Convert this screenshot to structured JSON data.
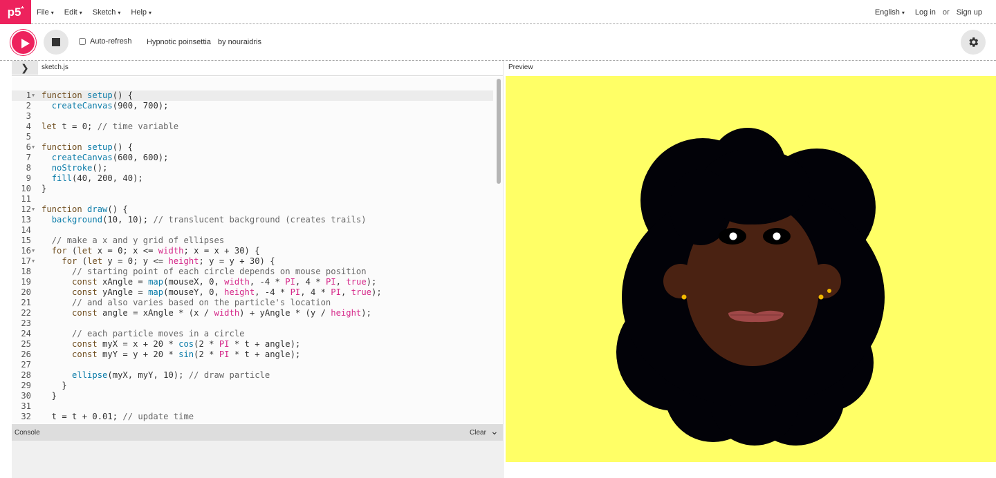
{
  "nav": {
    "logo": "p5",
    "logo_sup": "*",
    "menu": [
      "File",
      "Edit",
      "Sketch",
      "Help"
    ],
    "caret": "▾",
    "language": "English",
    "login": "Log in",
    "or": "or",
    "signup": "Sign up"
  },
  "toolbar": {
    "autorefresh_label": "Auto-refresh",
    "autorefresh_checked": false,
    "sketch_name": "Hypnotic poinsettia",
    "author": "by nouraidris"
  },
  "editor": {
    "file_tab": "sketch.js",
    "collapse_icon": "chevron-right-icon",
    "preview_label": "Preview",
    "active_line": 1,
    "lines": [
      {
        "n": "1",
        "fold": true,
        "text": "function setup() {"
      },
      {
        "n": "2",
        "fold": false,
        "text": "  createCanvas(900, 700);"
      },
      {
        "n": "3",
        "fold": false,
        "text": ""
      },
      {
        "n": "4",
        "fold": false,
        "text": "let t = 0; // time variable"
      },
      {
        "n": "5",
        "fold": false,
        "text": ""
      },
      {
        "n": "6",
        "fold": true,
        "text": "function setup() {"
      },
      {
        "n": "7",
        "fold": false,
        "text": "  createCanvas(600, 600);"
      },
      {
        "n": "8",
        "fold": false,
        "text": "  noStroke();"
      },
      {
        "n": "9",
        "fold": false,
        "text": "  fill(40, 200, 40);"
      },
      {
        "n": "10",
        "fold": false,
        "text": "}"
      },
      {
        "n": "11",
        "fold": false,
        "text": ""
      },
      {
        "n": "12",
        "fold": true,
        "text": "function draw() {"
      },
      {
        "n": "13",
        "fold": false,
        "text": "  background(10, 10); // translucent background (creates trails)"
      },
      {
        "n": "14",
        "fold": false,
        "text": ""
      },
      {
        "n": "15",
        "fold": false,
        "text": "  // make a x and y grid of ellipses"
      },
      {
        "n": "16",
        "fold": true,
        "text": "  for (let x = 0; x <= width; x = x + 30) {"
      },
      {
        "n": "17",
        "fold": true,
        "text": "    for (let y = 0; y <= height; y = y + 30) {"
      },
      {
        "n": "18",
        "fold": false,
        "text": "      // starting point of each circle depends on mouse position"
      },
      {
        "n": "19",
        "fold": false,
        "text": "      const xAngle = map(mouseX, 0, width, -4 * PI, 4 * PI, true);"
      },
      {
        "n": "20",
        "fold": false,
        "text": "      const yAngle = map(mouseY, 0, height, -4 * PI, 4 * PI, true);"
      },
      {
        "n": "21",
        "fold": false,
        "text": "      // and also varies based on the particle's location"
      },
      {
        "n": "22",
        "fold": false,
        "text": "      const angle = xAngle * (x / width) + yAngle * (y / height);"
      },
      {
        "n": "23",
        "fold": false,
        "text": ""
      },
      {
        "n": "24",
        "fold": false,
        "text": "      // each particle moves in a circle"
      },
      {
        "n": "25",
        "fold": false,
        "text": "      const myX = x + 20 * cos(2 * PI * t + angle);"
      },
      {
        "n": "26",
        "fold": false,
        "text": "      const myY = y + 20 * sin(2 * PI * t + angle);"
      },
      {
        "n": "27",
        "fold": false,
        "text": ""
      },
      {
        "n": "28",
        "fold": false,
        "text": "      ellipse(myX, myY, 10); // draw particle"
      },
      {
        "n": "29",
        "fold": false,
        "text": "    }"
      },
      {
        "n": "30",
        "fold": false,
        "text": "  }"
      },
      {
        "n": "31",
        "fold": false,
        "text": ""
      },
      {
        "n": "32",
        "fold": false,
        "text": "  t = t + 0.01; // update time"
      }
    ]
  },
  "console": {
    "title": "Console",
    "clear": "Clear",
    "collapse_icon": "chevron-down-icon"
  },
  "colors": {
    "accent": "#ed225d",
    "preview_bg": "#ffff66",
    "hair": "#020208",
    "skin": "#4a2212",
    "lips": "#a04848",
    "earrings": "#f2b800"
  },
  "icons": {
    "play": "play-icon",
    "stop": "stop-icon",
    "settings": "gear-icon"
  }
}
